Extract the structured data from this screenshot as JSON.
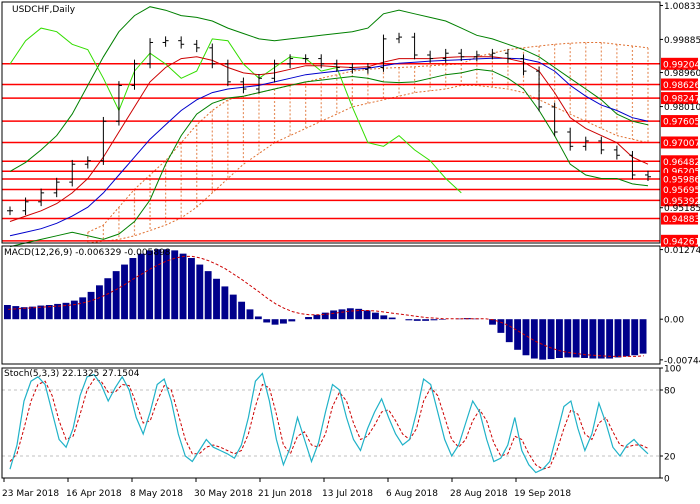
{
  "colors": {
    "background": "#ffffff",
    "axis": "#000000",
    "grid": "#c0c0c0",
    "price": "#000000",
    "bollinger": "#008000",
    "ema_fast": "#cc0000",
    "ema_slow": "#0000cc",
    "chikou": "#33dd00",
    "cloud": "#e07030",
    "level_line": "#ff0000",
    "level_box": "#ff0000",
    "level_text": "#ffffff",
    "macd_hist": "#00008b",
    "macd_signal": "#cc0000",
    "stoch_main": "#20b2c8",
    "stoch_signal": "#cc0000"
  },
  "chart_data": [
    {
      "type": "line",
      "title": "USDCHF,Daily",
      "x_dates": [
        "2018-03-23",
        "2018-03-28",
        "2018-04-02",
        "2018-04-06",
        "2018-04-11",
        "2018-04-16",
        "2018-04-20",
        "2018-04-25",
        "2018-04-30",
        "2018-05-04",
        "2018-05-08",
        "2018-05-14",
        "2018-05-18",
        "2018-05-23",
        "2018-05-28",
        "2018-05-30",
        "2018-06-04",
        "2018-06-08",
        "2018-06-13",
        "2018-06-18",
        "2018-06-21",
        "2018-06-26",
        "2018-06-29",
        "2018-07-04",
        "2018-07-09",
        "2018-07-13",
        "2018-07-18",
        "2018-07-23",
        "2018-07-27",
        "2018-08-01",
        "2018-08-06",
        "2018-08-10",
        "2018-08-15",
        "2018-08-20",
        "2018-08-24",
        "2018-08-28",
        "2018-09-03",
        "2018-09-07",
        "2018-09-12",
        "2018-09-17",
        "2018-09-19",
        "2018-09-21"
      ],
      "close": [
        0.951,
        0.9535,
        0.956,
        0.959,
        0.964,
        0.965,
        0.976,
        0.986,
        0.992,
        0.998,
        0.9985,
        0.9975,
        0.9965,
        0.992,
        0.987,
        0.985,
        0.988,
        0.992,
        0.9935,
        0.9935,
        0.992,
        0.991,
        0.9905,
        0.991,
        0.999,
        0.9995,
        0.9945,
        0.9935,
        0.995,
        0.994,
        0.9945,
        0.995,
        0.9935,
        0.99,
        0.98,
        0.973,
        0.969,
        0.9705,
        0.968,
        0.9665,
        0.961,
        0.9605
      ],
      "bollinger_upper": [
        0.962,
        0.9645,
        0.968,
        0.972,
        0.978,
        0.986,
        0.994,
        1.001,
        1.0055,
        1.008,
        1.007,
        1.0055,
        1.005,
        1.004,
        1.002,
        1.0005,
        0.999,
        0.9985,
        0.999,
        0.9995,
        1.0,
        1.0005,
        1.001,
        1.002,
        1.006,
        1.007,
        1.006,
        1.005,
        1.004,
        1.002,
        1.0,
        0.999,
        0.9975,
        0.996,
        0.994,
        0.991,
        0.988,
        0.985,
        0.982,
        0.978,
        0.976,
        0.975
      ],
      "bollinger_lower": [
        0.941,
        0.942,
        0.943,
        0.944,
        0.945,
        0.944,
        0.943,
        0.9445,
        0.948,
        0.954,
        0.964,
        0.972,
        0.978,
        0.981,
        0.9825,
        0.983,
        0.984,
        0.985,
        0.986,
        0.987,
        0.9875,
        0.988,
        0.9885,
        0.988,
        0.987,
        0.9868,
        0.987,
        0.988,
        0.989,
        0.9895,
        0.9905,
        0.99,
        0.988,
        0.985,
        0.979,
        0.972,
        0.964,
        0.961,
        0.96,
        0.96,
        0.9585,
        0.958
      ],
      "ema_fast": [
        0.948,
        0.9495,
        0.951,
        0.953,
        0.956,
        0.96,
        0.966,
        0.973,
        0.98,
        0.987,
        0.991,
        0.9935,
        0.994,
        0.993,
        0.991,
        0.9895,
        0.989,
        0.9895,
        0.9905,
        0.9915,
        0.9915,
        0.9912,
        0.991,
        0.9912,
        0.9925,
        0.9935,
        0.9935,
        0.9935,
        0.9938,
        0.994,
        0.994,
        0.994,
        0.9935,
        0.9925,
        0.99,
        0.984,
        0.977,
        0.974,
        0.972,
        0.97,
        0.966,
        0.964
      ],
      "ema_slow": [
        0.944,
        0.945,
        0.946,
        0.9475,
        0.9495,
        0.952,
        0.956,
        0.961,
        0.966,
        0.971,
        0.975,
        0.979,
        0.982,
        0.984,
        0.985,
        0.9855,
        0.986,
        0.987,
        0.988,
        0.989,
        0.9895,
        0.99,
        0.9905,
        0.9908,
        0.9915,
        0.9922,
        0.9925,
        0.9928,
        0.993,
        0.9932,
        0.9934,
        0.9936,
        0.9936,
        0.9934,
        0.9925,
        0.99,
        0.986,
        0.983,
        0.9805,
        0.979,
        0.977,
        0.976
      ],
      "chikou": [
        0.992,
        0.9985,
        1.002,
        1.001,
        0.9975,
        0.996,
        0.988,
        0.979,
        0.99,
        0.995,
        0.992,
        0.988,
        0.99,
        0.999,
        0.9985,
        0.992,
        0.988,
        0.991,
        0.994,
        0.9935,
        0.99,
        0.991,
        0.98,
        0.97,
        0.969,
        0.972,
        0.968,
        0.965,
        0.96,
        0.956,
        null,
        null,
        null,
        null,
        null,
        null,
        null,
        null,
        null,
        null,
        null,
        null
      ],
      "cloud_a": [
        null,
        null,
        null,
        null,
        null,
        0.945,
        0.947,
        0.952,
        0.957,
        0.961,
        0.965,
        0.97,
        0.975,
        0.979,
        0.982,
        0.983,
        0.984,
        0.985,
        0.986,
        0.987,
        0.988,
        0.989,
        0.99,
        0.9905,
        0.9908,
        0.991,
        0.9912,
        0.9915,
        0.9918,
        0.992,
        0.994,
        0.995,
        0.996,
        0.9965,
        0.997,
        0.9975,
        0.9978,
        0.998,
        0.998,
        0.9975,
        0.997,
        0.9965
      ],
      "cloud_b": [
        null,
        null,
        null,
        null,
        null,
        0.942,
        0.9425,
        0.943,
        0.944,
        0.9455,
        0.947,
        0.949,
        0.952,
        0.956,
        0.96,
        0.964,
        0.967,
        0.97,
        0.972,
        0.974,
        0.976,
        0.978,
        0.98,
        0.981,
        0.982,
        0.983,
        0.984,
        0.9845,
        0.985,
        0.986,
        0.986,
        0.9855,
        0.985,
        0.984,
        0.982,
        0.98,
        0.978,
        0.976,
        0.974,
        0.972,
        0.971,
        0.97
      ],
      "ylim": [
        0.942,
        1.0093
      ],
      "y_tick_labels": [
        "1.00833",
        "0.99885",
        "0.98960",
        "0.98010",
        "0.95185"
      ],
      "levels": [
        "0.99204",
        "0.98626",
        "0.98247",
        "0.97605",
        "0.97007",
        "0.96482",
        "0.96205",
        "0.95986",
        "0.95695",
        "0.95392",
        "0.94883",
        "0.94261"
      ],
      "x_tick_labels": [
        "23 Mar 2018",
        "16 Apr 2018",
        "8 May 2018",
        "30 May 2018",
        "21 Jun 2018",
        "13 Jul 2018",
        "6 Aug 2018",
        "28 Aug 2018",
        "19 Sep 2018"
      ],
      "grid": false
    },
    {
      "type": "bar",
      "title": "MACD(12,26,9) -0.006329 -0.005898",
      "values": [
        0.0026,
        0.0024,
        0.0022,
        0.0023,
        0.0025,
        0.0026,
        0.0028,
        0.003,
        0.0034,
        0.004,
        0.005,
        0.0062,
        0.0075,
        0.0088,
        0.01,
        0.0112,
        0.012,
        0.0126,
        0.0128,
        0.0128,
        0.0126,
        0.012,
        0.0112,
        0.01,
        0.0088,
        0.0074,
        0.006,
        0.0045,
        0.0032,
        0.0018,
        0.0005,
        -0.0006,
        -0.001,
        -0.0008,
        -0.0004,
        0.0,
        0.0004,
        0.0008,
        0.0012,
        0.0016,
        0.0018,
        0.002,
        0.0019,
        0.0016,
        0.0012,
        0.0007,
        0.0003,
        0.0,
        -0.0002,
        -0.0003,
        -0.0003,
        -0.0002,
        -0.0001,
        0.0,
        0.0001,
        0.0002,
        0.0001,
        0.0,
        -0.001,
        -0.0025,
        -0.0042,
        -0.0056,
        -0.0066,
        -0.0072,
        -0.0074,
        -0.0073,
        -0.0071,
        -0.007,
        -0.007,
        -0.0071,
        -0.0072,
        -0.0072,
        -0.0072,
        -0.007,
        -0.0068,
        -0.0066,
        -0.0063
      ],
      "signal": [
        0.0018,
        0.0019,
        0.002,
        0.0021,
        0.0022,
        0.0023,
        0.0024,
        0.0025,
        0.0027,
        0.003,
        0.0034,
        0.004,
        0.0047,
        0.0055,
        0.0064,
        0.0074,
        0.0083,
        0.0092,
        0.01,
        0.0107,
        0.0112,
        0.0115,
        0.0115,
        0.0112,
        0.0107,
        0.01,
        0.0092,
        0.0082,
        0.0072,
        0.0061,
        0.005,
        0.0038,
        0.0028,
        0.002,
        0.0014,
        0.001,
        0.0008,
        0.0008,
        0.0009,
        0.0011,
        0.0013,
        0.0015,
        0.0016,
        0.0016,
        0.0015,
        0.0013,
        0.0011,
        0.0009,
        0.0007,
        0.0005,
        0.0003,
        0.0002,
        0.0001,
        0.0001,
        0.0001,
        0.0001,
        0.0001,
        0.0001,
        -0.0001,
        -0.0006,
        -0.0013,
        -0.0022,
        -0.0031,
        -0.004,
        -0.0047,
        -0.0053,
        -0.0058,
        -0.0061,
        -0.0063,
        -0.0065,
        -0.0066,
        -0.0067,
        -0.0068,
        -0.0068,
        -0.0068,
        -0.0068,
        -0.0067
      ],
      "ylim": [
        -0.0082,
        0.0134
      ],
      "y_tick_labels": [
        "0.012745",
        "0.00",
        "-0.007443"
      ]
    },
    {
      "type": "line",
      "title": "Stoch(5,3,3) 22.1325 27.1504",
      "main": [
        8,
        30,
        70,
        88,
        92,
        85,
        60,
        35,
        28,
        45,
        75,
        92,
        94,
        85,
        70,
        82,
        92,
        80,
        55,
        40,
        60,
        85,
        90,
        70,
        40,
        20,
        15,
        25,
        35,
        28,
        25,
        22,
        18,
        30,
        55,
        88,
        95,
        70,
        35,
        12,
        28,
        55,
        35,
        15,
        32,
        60,
        85,
        80,
        55,
        35,
        25,
        45,
        60,
        72,
        55,
        40,
        30,
        35,
        60,
        90,
        85,
        60,
        35,
        20,
        30,
        50,
        70,
        60,
        35,
        15,
        18,
        30,
        55,
        25,
        12,
        5,
        8,
        15,
        40,
        65,
        70,
        45,
        25,
        40,
        68,
        50,
        28,
        20,
        30,
        35,
        28,
        22
      ],
      "signal": [
        15,
        22,
        45,
        70,
        85,
        88,
        75,
        52,
        35,
        38,
        58,
        80,
        90,
        88,
        78,
        78,
        85,
        84,
        68,
        50,
        52,
        70,
        84,
        80,
        58,
        35,
        22,
        22,
        28,
        30,
        28,
        25,
        22,
        25,
        40,
        65,
        85,
        82,
        58,
        30,
        22,
        38,
        42,
        30,
        28,
        40,
        65,
        78,
        70,
        50,
        35,
        38,
        48,
        60,
        62,
        52,
        40,
        35,
        45,
        70,
        82,
        75,
        55,
        35,
        28,
        35,
        52,
        62,
        52,
        32,
        20,
        22,
        38,
        35,
        22,
        12,
        8,
        10,
        25,
        45,
        62,
        58,
        40,
        35,
        50,
        55,
        42,
        30,
        28,
        30,
        30,
        27
      ],
      "ylim": [
        0,
        100
      ],
      "y_tick_labels": [
        "100",
        "80",
        "20",
        "0"
      ],
      "levels": [
        80,
        20
      ]
    }
  ]
}
